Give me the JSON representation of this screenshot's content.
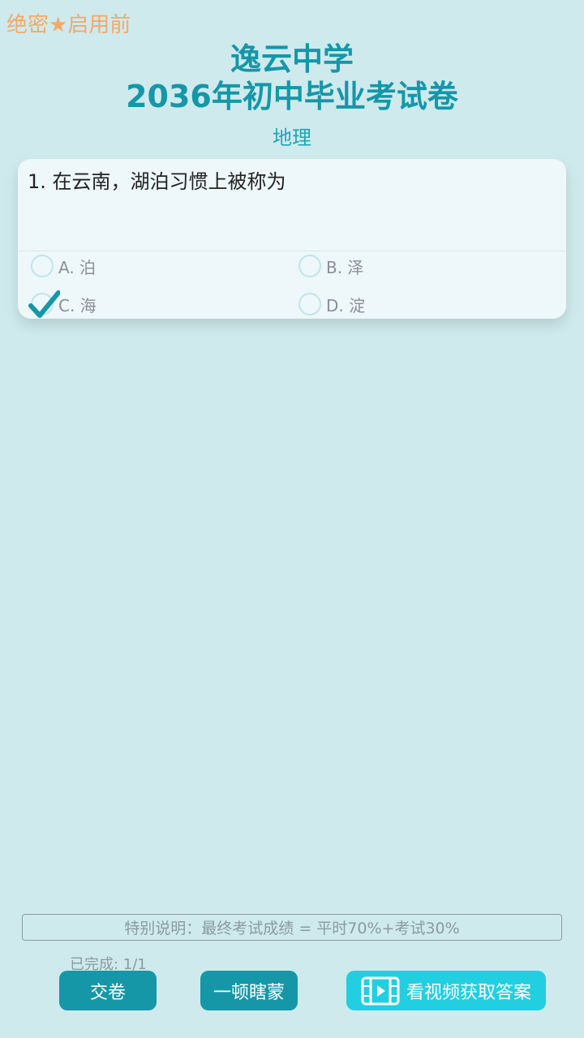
{
  "header": {
    "confidential": "绝密★启用前",
    "school": "逸云中学",
    "exam": "2036年初中毕业考试卷",
    "subject": "地理"
  },
  "question": {
    "text": "1.  在云南，湖泊习惯上被称为",
    "options": [
      {
        "label": "A. 泊",
        "selected": false
      },
      {
        "label": "B. 泽",
        "selected": false
      },
      {
        "label": "C. 海",
        "selected": true
      },
      {
        "label": "D. 淀",
        "selected": false
      }
    ]
  },
  "footer": {
    "notice": "特别说明：最终考试成绩 = 平时70%+考试30%",
    "progress": "已完成: 1/1",
    "submit": "交卷",
    "guess": "一顿瞎蒙",
    "video": "看视频获取答案"
  },
  "icons": {
    "check": "check-icon",
    "video": "film-icon"
  },
  "colors": {
    "background": "#ceeaed",
    "accent": "#1597a8",
    "video_button": "#22cfe0",
    "confidential": "#f4a86a"
  }
}
